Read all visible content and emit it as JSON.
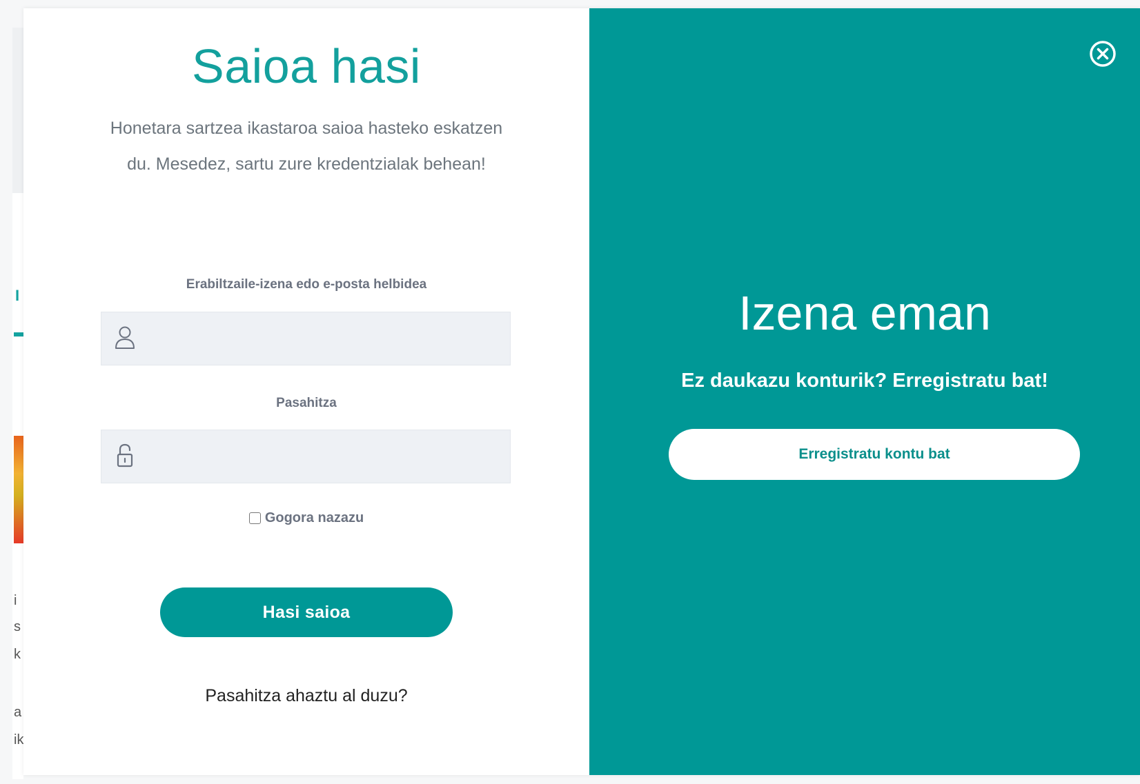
{
  "login": {
    "title": "Saioa hasi",
    "description": "Honetara sartzea ikastaroa saioa hasteko eskatzen du. Mesedez, sartu zure kredentzialak behean!",
    "username_label": "Erabiltzaile-izena edo e-posta helbidea",
    "username_value": "",
    "username_icon": "user-icon",
    "password_label": "Pasahitza",
    "password_value": "",
    "password_icon": "lock-icon",
    "remember_label": "Gogora nazazu",
    "remember_checked": false,
    "submit_label": "Hasi saioa",
    "forgot_label": "Pasahitza ahaztu al duzu?"
  },
  "register": {
    "title": "Izena eman",
    "subtitle": "Ez daukazu konturik? Erregistratu bat!",
    "button_label": "Erregistratu kontu bat",
    "close_icon": "close-circle-icon"
  },
  "colors": {
    "accent": "#009896",
    "title_teal": "#13a09d",
    "input_bg": "#eef1f5",
    "panel_white": "#ffffff"
  }
}
